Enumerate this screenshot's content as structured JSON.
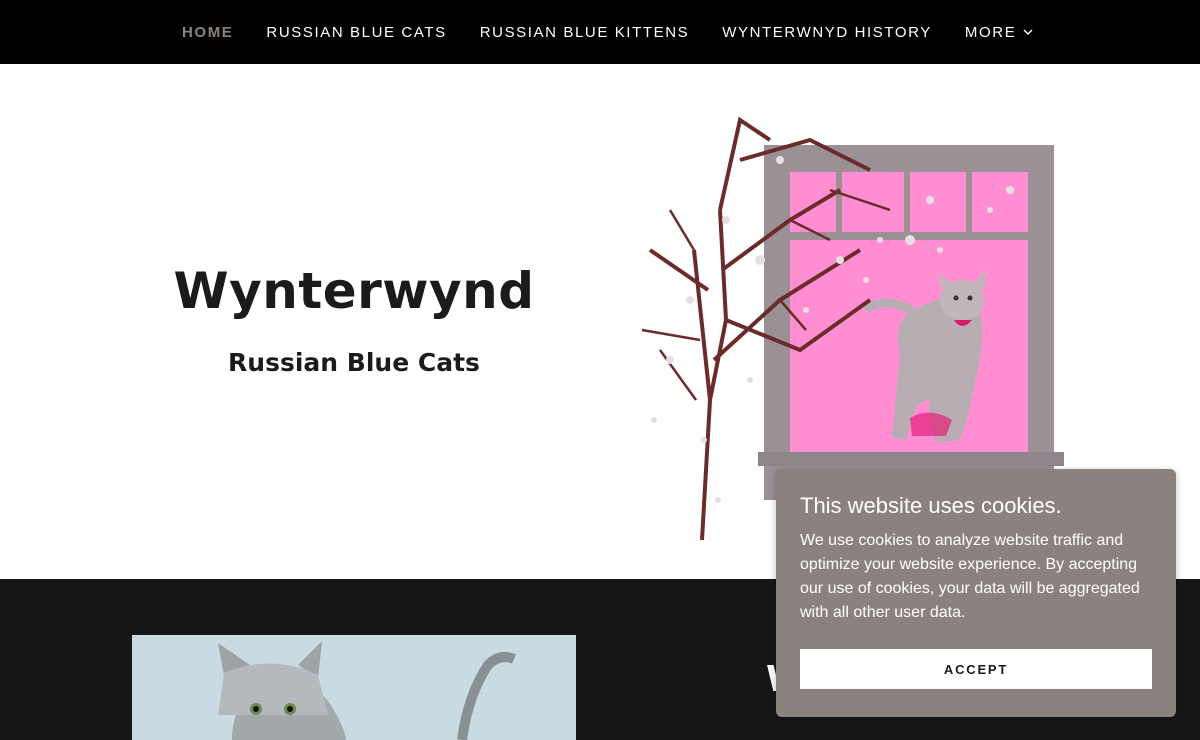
{
  "nav": {
    "items": [
      {
        "label": "HOME",
        "active": true
      },
      {
        "label": "RUSSIAN BLUE CATS",
        "active": false
      },
      {
        "label": "RUSSIAN BLUE KITTENS",
        "active": false
      },
      {
        "label": "WYNTERWNYD HISTORY",
        "active": false
      },
      {
        "label": "MORE",
        "active": false,
        "has_dropdown": true
      }
    ]
  },
  "hero": {
    "title": "Wynterwynd",
    "subtitle": "Russian Blue Cats",
    "image_icon": "cat-in-window-image"
  },
  "section2": {
    "heading_partial": "W",
    "image_icon": "kitten-photo"
  },
  "cookie_banner": {
    "title": "This website uses cookies.",
    "text": "We use cookies to analyze website traffic and optimize your website experience. By accepting our use of cookies, your data will be aggregated with all other user data.",
    "accept_label": "ACCEPT"
  },
  "colors": {
    "nav_bg": "#000000",
    "nav_active": "#8c837f",
    "dark_section_bg": "#161616",
    "cookie_bg": "#8b817e",
    "window_pink": "#ff8fd2"
  }
}
